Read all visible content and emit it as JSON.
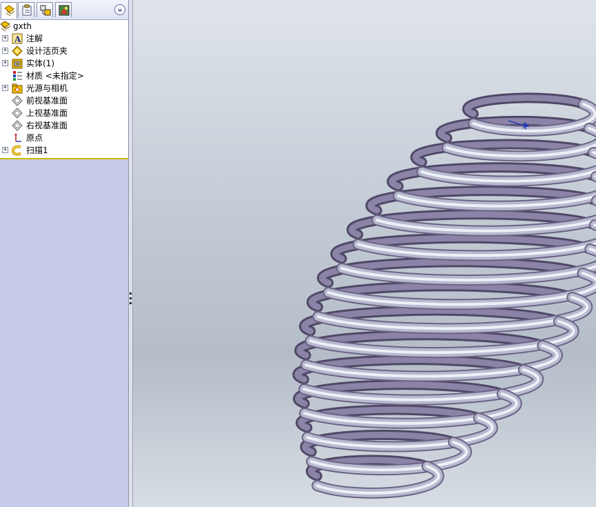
{
  "tabs": [
    {
      "name": "feature-manager",
      "icon": "feature-tree-icon"
    },
    {
      "name": "property-manager",
      "icon": "property-manager-icon"
    },
    {
      "name": "configuration-manager",
      "icon": "configuration-manager-icon"
    },
    {
      "name": "display-manager",
      "icon": "display-manager-icon"
    }
  ],
  "expand_label": "»",
  "tree": {
    "root": {
      "label": "gxth",
      "icon": "part-icon"
    },
    "items": [
      {
        "label": "注解",
        "icon": "annotations-icon",
        "expandable": true
      },
      {
        "label": "设计活页夹",
        "icon": "design-binder-icon",
        "expandable": true
      },
      {
        "label": "实体(1)",
        "icon": "solid-bodies-icon",
        "expandable": true
      },
      {
        "label": "材质 <未指定>",
        "icon": "material-icon",
        "expandable": false
      },
      {
        "label": "光源与相机",
        "icon": "lights-cameras-icon",
        "expandable": true
      },
      {
        "label": "前视基准面",
        "icon": "plane-icon",
        "expandable": false
      },
      {
        "label": "上视基准面",
        "icon": "plane-icon",
        "expandable": false
      },
      {
        "label": "右视基准面",
        "icon": "plane-icon",
        "expandable": false
      },
      {
        "label": "原点",
        "icon": "origin-icon",
        "expandable": false
      },
      {
        "label": "扫描1",
        "icon": "sweep-icon",
        "expandable": true
      }
    ]
  },
  "colors": {
    "panel_bg": "#c7cbe8",
    "tree_bg": "#ffffff",
    "separator": "#c8b800",
    "spring_light": "#eceef6",
    "spring_mid": "#b9bcd2",
    "spring_dark": "#76708e"
  }
}
